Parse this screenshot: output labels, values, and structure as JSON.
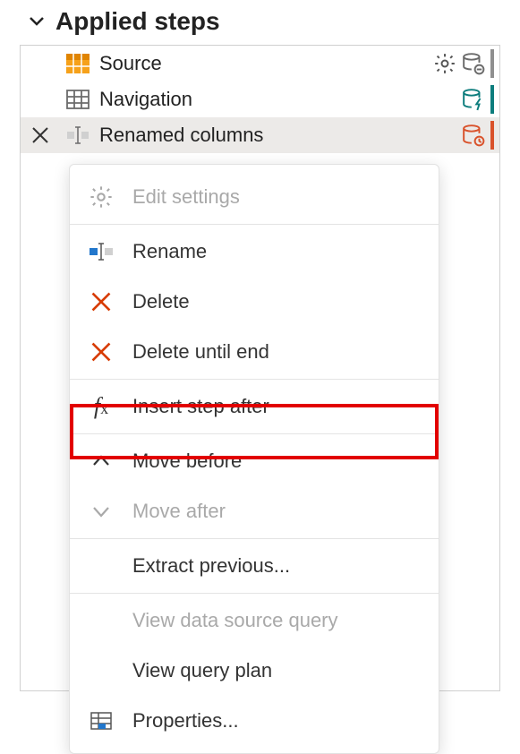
{
  "panel": {
    "title": "Applied steps"
  },
  "steps": [
    {
      "label": "Source"
    },
    {
      "label": "Navigation"
    },
    {
      "label": "Renamed columns"
    }
  ],
  "menu": {
    "edit_settings": "Edit settings",
    "rename": "Rename",
    "delete": "Delete",
    "delete_until_end": "Delete until end",
    "insert_step_after": "Insert step after",
    "move_before": "Move before",
    "move_after": "Move after",
    "extract_previous": "Extract previous...",
    "view_data_source_query": "View data source query",
    "view_query_plan": "View query plan",
    "properties": "Properties..."
  },
  "colors": {
    "bar_source": "#8f8f8f",
    "bar_navigation": "#0d7d7d",
    "bar_renamed": "#d9522b"
  }
}
